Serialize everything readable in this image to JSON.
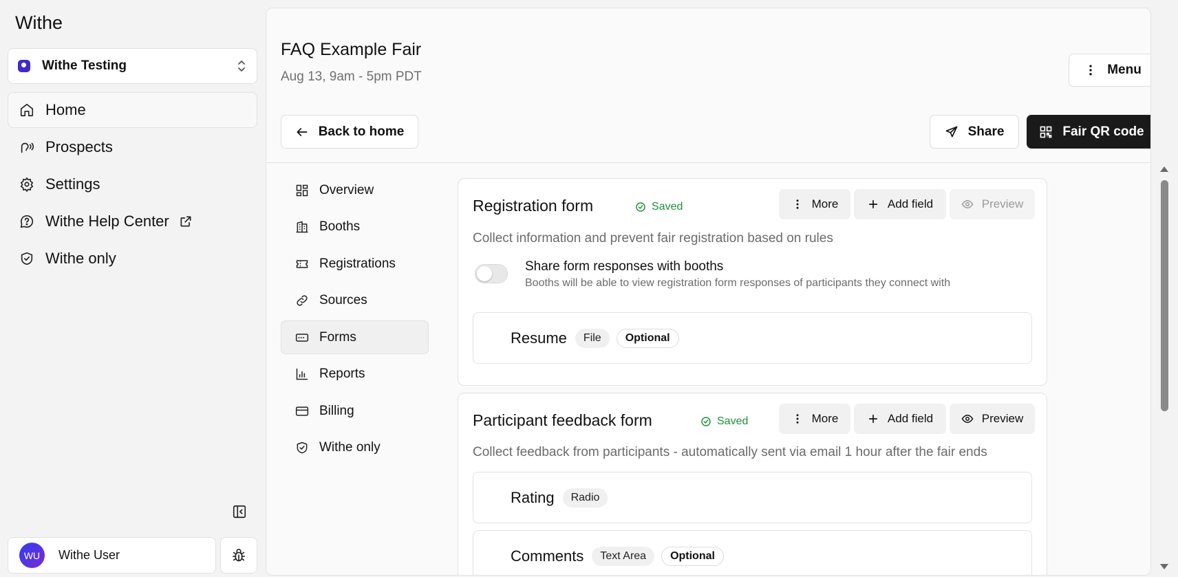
{
  "sidebar": {
    "app_name": "Withe",
    "org_name": "Withe Testing",
    "nav": [
      {
        "label": "Home",
        "icon": "home-icon"
      },
      {
        "label": "Prospects",
        "icon": "prospects-icon"
      },
      {
        "label": "Settings",
        "icon": "gear-icon"
      },
      {
        "label": "Withe Help Center",
        "icon": "help-icon",
        "external": true
      },
      {
        "label": "Withe only",
        "icon": "shield-icon"
      }
    ],
    "user": {
      "initials": "WU",
      "name": "Withe User"
    }
  },
  "header": {
    "title": "FAQ Example Fair",
    "subtitle": "Aug 13, 9am - 5pm PDT",
    "menu_label": "Menu",
    "back_label": "Back to home",
    "share_label": "Share",
    "qr_label": "Fair QR code"
  },
  "subnav": [
    {
      "label": "Overview",
      "icon": "overview-icon"
    },
    {
      "label": "Booths",
      "icon": "building-icon"
    },
    {
      "label": "Registrations",
      "icon": "ticket-icon"
    },
    {
      "label": "Sources",
      "icon": "link-icon"
    },
    {
      "label": "Forms",
      "icon": "form-icon",
      "active": true
    },
    {
      "label": "Reports",
      "icon": "chart-icon"
    },
    {
      "label": "Billing",
      "icon": "card-icon"
    },
    {
      "label": "Withe only",
      "icon": "shield-icon"
    }
  ],
  "forms": [
    {
      "title": "Registration form",
      "status": "Saved",
      "description": "Collect information and prevent fair registration based on rules",
      "more_label": "More",
      "add_label": "Add field",
      "preview_label": "Preview",
      "preview_enabled": false,
      "share_toggle": {
        "title": "Share form responses with booths",
        "subtitle": "Booths will be able to view registration form responses of participants they connect with",
        "on": false
      },
      "fields": [
        {
          "label": "Resume",
          "type": "File",
          "optional": "Optional"
        }
      ]
    },
    {
      "title": "Participant feedback form",
      "status": "Saved",
      "description": "Collect feedback from participants - automatically sent via email 1 hour after the fair ends",
      "more_label": "More",
      "add_label": "Add field",
      "preview_label": "Preview",
      "preview_enabled": true,
      "fields": [
        {
          "label": "Rating",
          "type": "Radio"
        },
        {
          "label": "Comments",
          "type": "Text Area",
          "optional": "Optional"
        }
      ]
    }
  ],
  "colors": {
    "accent": "#4328c8",
    "saved": "#1f8f3a",
    "primary_button": "#1a1a1a"
  }
}
